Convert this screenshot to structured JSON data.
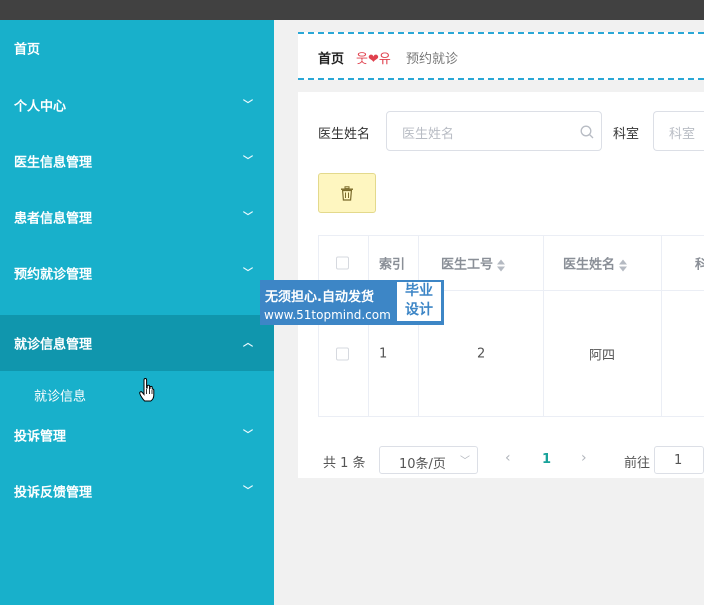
{
  "sidebar": {
    "items": [
      {
        "label": "首页",
        "chevron": ""
      },
      {
        "label": "个人中心",
        "chevron": "﹀"
      },
      {
        "label": "医生信息管理",
        "chevron": "﹀"
      },
      {
        "label": "患者信息管理",
        "chevron": "﹀"
      },
      {
        "label": "预约就诊管理",
        "chevron": "﹀"
      },
      {
        "label": "就诊信息管理",
        "chevron": "︿",
        "active": true
      },
      {
        "label": "投诉管理",
        "chevron": "﹀"
      },
      {
        "label": "投诉反馈管理",
        "chevron": "﹀"
      }
    ],
    "submenu": [
      {
        "label": "就诊信息"
      }
    ]
  },
  "breadcrumb": {
    "home": "首页",
    "separator": "웃❤유",
    "current": "预约就诊"
  },
  "search": {
    "doctor_label": "医生姓名",
    "doctor_placeholder": "医生姓名",
    "dept_label": "科室",
    "dept_placeholder": "科室"
  },
  "toolbar": {
    "delete_icon": "trash-icon"
  },
  "table": {
    "headers": [
      "索引",
      "医生工号",
      "医生姓名",
      "科"
    ],
    "rows": [
      {
        "index": "1",
        "doctor_id": "2",
        "doctor_name": "阿四"
      }
    ]
  },
  "pagination": {
    "total": "共 1 条",
    "page_size": "10条/页",
    "current_page": "1",
    "goto_label": "前往",
    "goto_value": "1"
  },
  "watermark": {
    "line1": "无须担心.自动发货",
    "line2": "www.51topmind.com",
    "badge_line1": "毕业",
    "badge_line2": "设计"
  },
  "colors": {
    "sidebar": "#18b0cb",
    "sidebar_active": "#1096ad",
    "topbar": "#414141",
    "accent": "#18a29a",
    "breadcrumb_border": "#2aa7d6"
  }
}
